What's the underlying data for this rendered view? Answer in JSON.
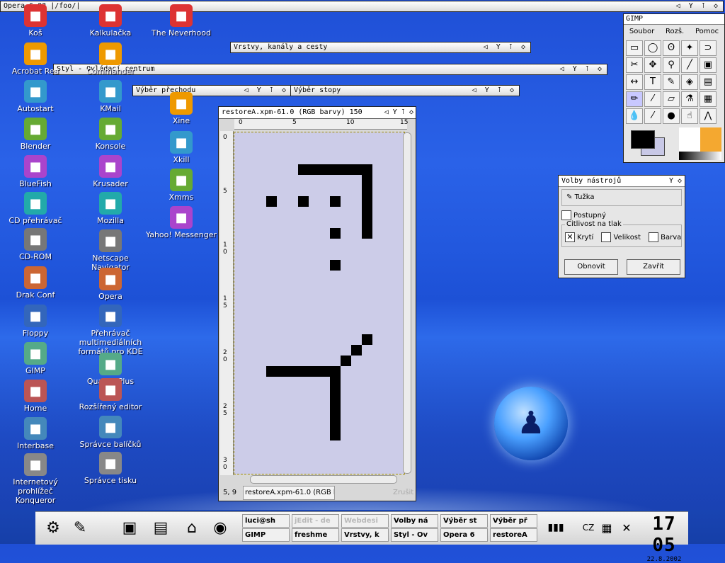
{
  "top_window": {
    "title": "Opera 6.02  |/foo/|"
  },
  "desktop_icons_col1": [
    {
      "label": "Koš",
      "icon": "trash-icon"
    },
    {
      "label": "Acrobat Rea",
      "icon": "acrobat-icon"
    },
    {
      "label": "Autostart",
      "icon": "folder-icon"
    },
    {
      "label": "Blender",
      "icon": "blender-icon"
    },
    {
      "label": "BlueFish",
      "icon": "fish-icon"
    },
    {
      "label": "CD přehrávač",
      "icon": "cd-player-icon"
    },
    {
      "label": "CD-ROM",
      "icon": "cdrom-icon"
    },
    {
      "label": "Drak Conf",
      "icon": "drakconf-icon"
    },
    {
      "label": "Floppy",
      "icon": "floppy-icon"
    },
    {
      "label": "GIMP",
      "icon": "gimp-icon"
    },
    {
      "label": "Home",
      "icon": "home-icon"
    },
    {
      "label": "Interbase",
      "icon": "interbase-icon"
    },
    {
      "label": "Internetový prohlížeč Konqueror",
      "icon": "konqueror-icon"
    }
  ],
  "desktop_icons_col2": [
    {
      "label": "Kalkulačka",
      "icon": "calculator-icon"
    },
    {
      "label": "Commander",
      "icon": "commander-icon"
    },
    {
      "label": "KMail",
      "icon": "kmail-icon"
    },
    {
      "label": "Konsole",
      "icon": "konsole-icon"
    },
    {
      "label": "Krusader",
      "icon": "krusader-icon"
    },
    {
      "label": "Mozilla",
      "icon": "mozilla-icon"
    },
    {
      "label": "Netscape Navigator",
      "icon": "netscape-icon"
    },
    {
      "label": "Opera",
      "icon": "opera-icon"
    },
    {
      "label": "Přehrávač multimediálních formátů pro KDE",
      "icon": "media-player-icon"
    },
    {
      "label": "Quanta Plus",
      "icon": "quanta-icon"
    },
    {
      "label": "Rozšířený editor",
      "icon": "editor-icon"
    },
    {
      "label": "Správce balíčků",
      "icon": "package-icon"
    },
    {
      "label": "Správce tisku",
      "icon": "printer-icon"
    }
  ],
  "desktop_icons_col3": [
    {
      "label": "The Neverhood",
      "icon": "neverhood-icon"
    },
    {
      "label": "Xine",
      "icon": "xine-icon"
    },
    {
      "label": "Xkill",
      "icon": "xkill-icon"
    },
    {
      "label": "Xmms",
      "icon": "xmms-icon"
    },
    {
      "label": "Yahoo! Messenger",
      "icon": "yahoo-icon"
    }
  ],
  "windows": {
    "layers": "Vrstvy, kanály a cesty",
    "style": "Styl - Ovládací centrum",
    "gradient": "Výběr přechodu",
    "pattern": "Výběr stopy",
    "controls": "◁ Y ⊺ ◇"
  },
  "gimp": {
    "title": "GIMP",
    "menu": [
      "Soubor",
      "Rozš.",
      "Pomoc"
    ],
    "tools": [
      "▭",
      "◯",
      "ʘ",
      "✦",
      "⊃",
      "✂",
      "✥",
      "⚲",
      "╱",
      "▣",
      "↔",
      "T",
      "✎",
      "◈",
      "▤",
      "✏",
      "⁄",
      "▱",
      "⚗",
      "▦",
      "💧",
      "⁄",
      "●",
      "☝",
      "⋀"
    ]
  },
  "tool_options": {
    "title": "Volby nástrojů",
    "tool": "Tužka",
    "incremental": "Postupný",
    "pressure_group": "Citlivost na tlak",
    "opacity": "Krytí",
    "size": "Velikost",
    "color": "Barva",
    "reset": "Obnovit",
    "close": "Zavřít"
  },
  "image_window": {
    "title": "restoreA.xpm-61.0 (RGB barvy) 150",
    "hruler": [
      "0",
      "5",
      "10",
      "15"
    ],
    "vruler": [
      "0",
      "5",
      "1 0",
      "1 5",
      "2 0",
      "2 5",
      "3 0"
    ],
    "position": "5, 9",
    "status_name": "restoreA.xpm-61.0 (RGB bar",
    "zoom_btn": "Zrušit"
  },
  "taskbar": {
    "tasks_row1": [
      "luci@sh",
      "jEdit - de",
      "Webdesi",
      "Volby ná",
      "Výběr st",
      "Výběr př"
    ],
    "tasks_row2": [
      "GIMP",
      "freshme",
      "Vrstvy, k",
      "Styl - Ov",
      "Opera 6",
      "restoreA"
    ],
    "time": "17 05",
    "date": "22.8.2002"
  }
}
